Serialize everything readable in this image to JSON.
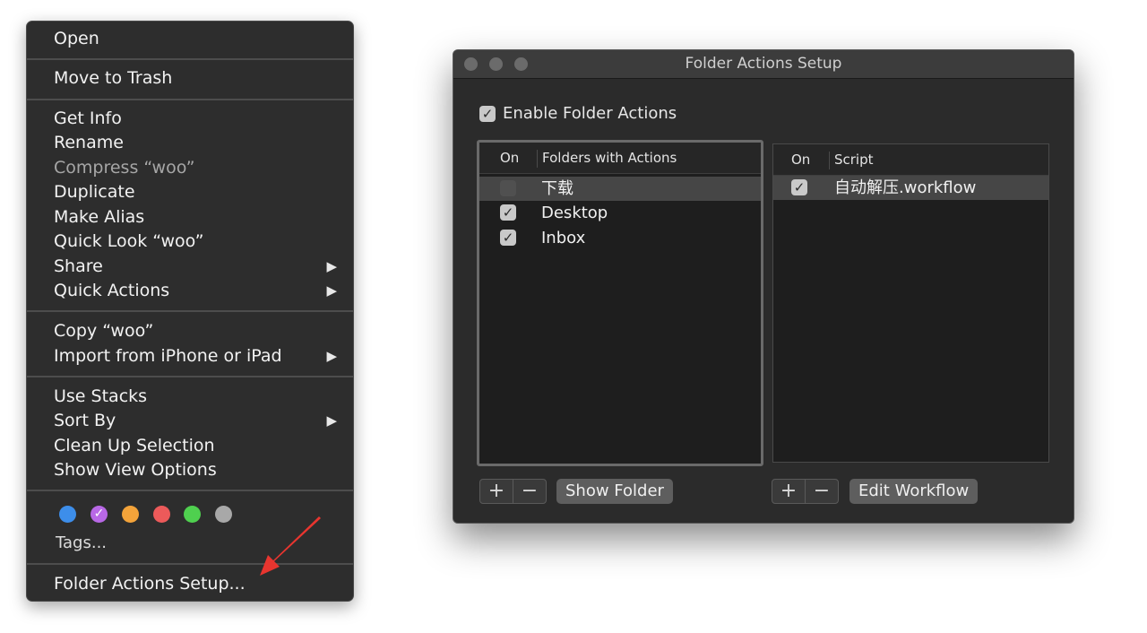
{
  "context_menu": {
    "open": "Open",
    "move_to_trash": "Move to Trash",
    "get_info": "Get Info",
    "rename": "Rename",
    "compress": "Compress “woo”",
    "duplicate": "Duplicate",
    "make_alias": "Make Alias",
    "quick_look": "Quick Look “woo”",
    "share": "Share",
    "quick_actions": "Quick Actions",
    "copy": "Copy “woo”",
    "import_iphone": "Import from iPhone or iPad",
    "use_stacks": "Use Stacks",
    "sort_by": "Sort By",
    "clean_up": "Clean Up Selection",
    "show_view_options": "Show View Options",
    "tags_label": "Tags...",
    "folder_actions_setup": "Folder Actions Setup...",
    "tag_colors": {
      "blue": "#3d8eea",
      "purple": "#b868e6",
      "orange": "#f3a33a",
      "red": "#ec5a5a",
      "green": "#4fd04f",
      "gray": "#a8a8a8"
    },
    "submenu_arrow": "▶",
    "tag_check": "✓"
  },
  "window": {
    "title": "Folder Actions Setup",
    "enable_label": "Enable Folder Actions",
    "enable_checked": true,
    "folders_table": {
      "col_on": "On",
      "col_name": "Folders with Actions",
      "rows": [
        {
          "name": "下载",
          "checked": false,
          "selected": true
        },
        {
          "name": "Desktop",
          "checked": true,
          "selected": false
        },
        {
          "name": "Inbox",
          "checked": true,
          "selected": false
        }
      ]
    },
    "scripts_table": {
      "col_on": "On",
      "col_name": "Script",
      "rows": [
        {
          "name": "自动解压.workflow",
          "checked": true,
          "selected": true
        }
      ]
    },
    "add_symbol": "+",
    "remove_symbol": "−",
    "show_folder": "Show Folder",
    "edit_workflow": "Edit Workflow",
    "check_glyph": "✓"
  },
  "colors": {
    "arrow_red": "#e8352f"
  }
}
